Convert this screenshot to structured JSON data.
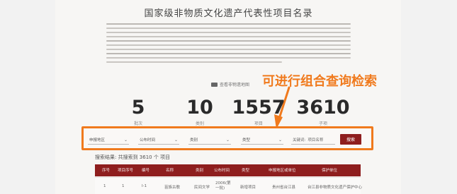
{
  "page": {
    "title": "国家级非物质文化遗产代表性项目名录"
  },
  "view_map": {
    "label": "查看非物遗地图"
  },
  "annotation": {
    "text": "可进行组合查询检索",
    "color": "#f07a1d"
  },
  "stats": [
    {
      "value": "5",
      "label": "批次"
    },
    {
      "value": "10",
      "label": "类别"
    },
    {
      "value": "1557",
      "label": "项目"
    },
    {
      "value": "3610",
      "label": "子项"
    }
  ],
  "filters": {
    "selects": [
      {
        "label": "申报地区"
      },
      {
        "label": "公布时间"
      },
      {
        "label": "类别"
      },
      {
        "label": "类型"
      }
    ],
    "keyword": {
      "label": "关键词:",
      "placeholder": "项目名称"
    },
    "search_button": {
      "label": "搜索"
    }
  },
  "results": {
    "text": "搜索结果: 共搜索到 3610 个 项目"
  },
  "table": {
    "columns": [
      "序号",
      "项目序号",
      "编号",
      "名称",
      "类别",
      "公布时间",
      "类型",
      "申报地区或单位",
      "保护单位"
    ],
    "rows": [
      [
        "1",
        "1",
        "I-1",
        "苗族古歌",
        "民间文学",
        "2006(第一批)",
        "新增项目",
        "贵州省台江县",
        "台江县非物质文化遗产保护中心"
      ]
    ]
  },
  "colors": {
    "accent": "#f07a1d",
    "table_header": "#8e1e1e",
    "search_button": "#8e1e1e"
  }
}
